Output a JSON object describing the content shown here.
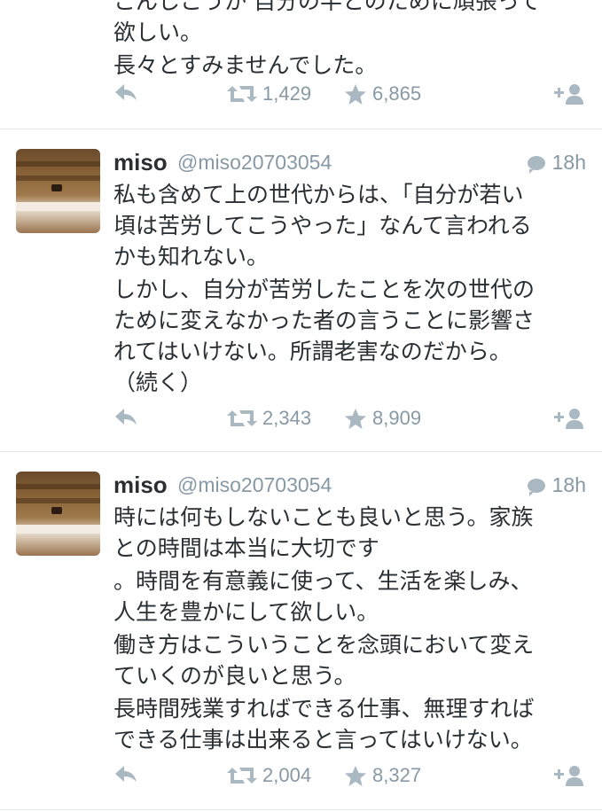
{
  "tweets": [
    {
      "partial_lines": [
        "こんしこうか 自分の半とのために頑張って",
        "欲しい。"
      ],
      "last_paragraph": "長々とすみませんでした。",
      "retweets": "1,429",
      "favorites": "6,865"
    },
    {
      "name": "miso",
      "handle": "@miso20703054",
      "time": "18h",
      "lines": [
        "私も含めて上の世代からは、「自分が若い",
        "頃は苦労してこうやった」なんて言われる",
        "かも知れない。",
        "しかし、自分が苦労したことを次の世代の",
        "ために変えなかった者の言うことに影響さ",
        "れてはいけない。所謂老害なのだから。",
        "（続く）"
      ],
      "retweets": "2,343",
      "favorites": "8,909"
    },
    {
      "name": "miso",
      "handle": "@miso20703054",
      "time": "18h",
      "lines": [
        "時には何もしないことも良いと思う。家族",
        "との時間は本当に大切です",
        "。時間を有意義に使って、生活を楽しみ、",
        "人生を豊かにして欲しい。",
        "働き方はこういうことを念頭において変え",
        "ていくのが良いと思う。",
        "長時間残業すればできる仕事、無理すれば",
        "できる仕事は出来ると言ってはいけない。"
      ],
      "retweets": "2,004",
      "favorites": "8,327"
    }
  ],
  "icons": {
    "reply": "reply-icon",
    "retweet": "retweet-icon",
    "favorite": "star-icon",
    "follow": "follow-icon",
    "conversation": "conversation-icon"
  },
  "colors": {
    "text": "#292f33",
    "muted": "#8899a6",
    "icon": "#aab8c2",
    "divider": "#e1e8ed"
  }
}
